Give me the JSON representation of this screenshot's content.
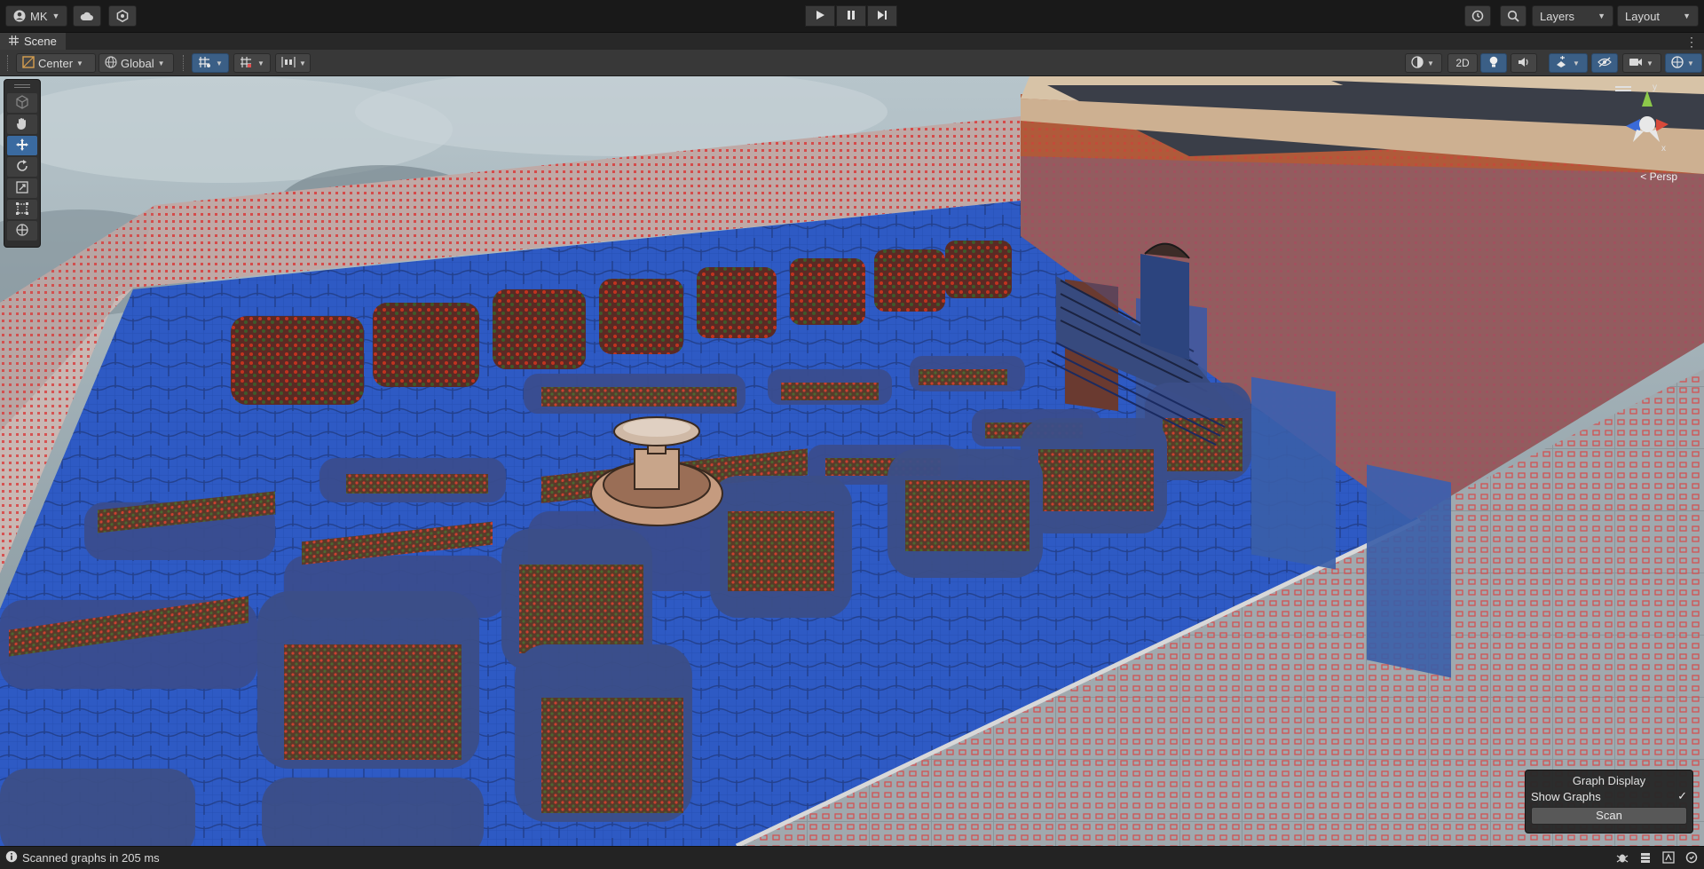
{
  "toolbar": {
    "account_label": "MK",
    "layers_label": "Layers",
    "layout_label": "Layout",
    "play_icon": "play-icon",
    "pause_icon": "pause-icon",
    "step_icon": "step-icon"
  },
  "tab": {
    "title": "Scene"
  },
  "scene_toolbar": {
    "pivot_label": "Center",
    "space_label": "Global",
    "view_2d_label": "2D"
  },
  "gizmo": {
    "projection_label": "< Persp"
  },
  "graph_display": {
    "title": "Graph Display",
    "show_graphs_label": "Show Graphs",
    "show_graphs_checked": "✓",
    "scan_label": "Scan"
  },
  "status": {
    "message": "Scanned graphs in 205 ms"
  },
  "colors": {
    "accent": "#3b5f86",
    "ground_blue": "#2d59c7",
    "graph_red": "#d83030",
    "toolbar_bg": "#191919"
  }
}
